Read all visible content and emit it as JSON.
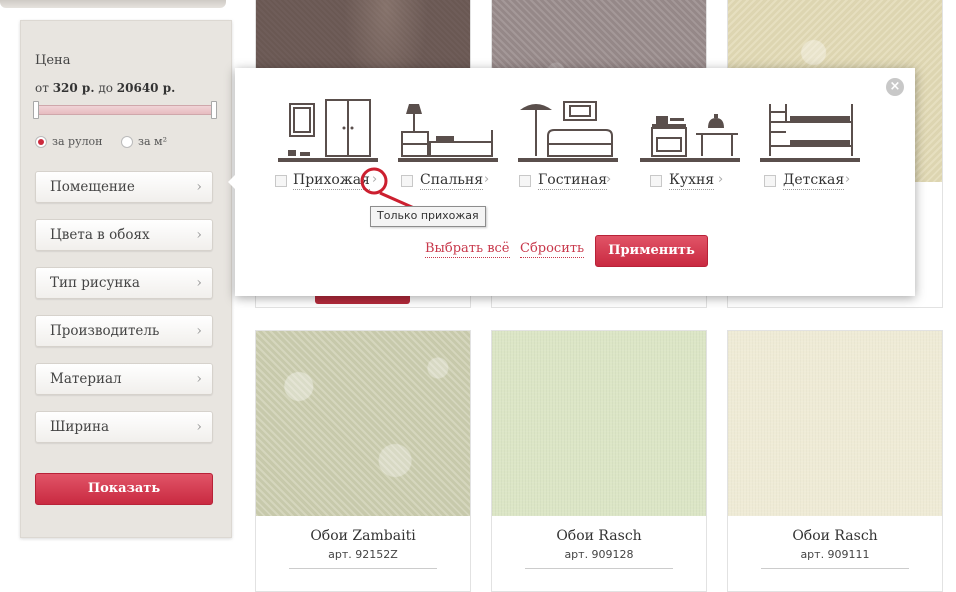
{
  "sidebar": {
    "price_title": "Цена",
    "price_from_label": "от",
    "price_from_value": "320 р.",
    "price_to_label": "до",
    "price_to_value": "20640 р.",
    "unit_options": [
      {
        "label": "за рулон",
        "selected": true
      },
      {
        "label": "за м²",
        "selected": false
      }
    ],
    "filters": [
      "Помещение",
      "Цвета в обоях",
      "Тип рисунка",
      "Производитель",
      "Материал",
      "Ширина"
    ],
    "show_button": "Показать"
  },
  "popup": {
    "rooms": [
      "Прихожая",
      "Спальня",
      "Гостиная",
      "Кухня",
      "Детская"
    ],
    "tooltip": "Только прихожая",
    "select_all": "Выбрать всё",
    "reset": "Сбросить",
    "apply": "Применить",
    "close_icon": "close-icon"
  },
  "products": [
    {
      "name": "Обои Zambaiti",
      "article": "арт. 92152Z"
    },
    {
      "name": "Обои Rasch",
      "article": "арт. 909128"
    },
    {
      "name": "Обои Rasch",
      "article": "арт. 909111"
    }
  ],
  "colors": {
    "accent": "#cc2a3d",
    "sidebar_bg": "#e8e5e0",
    "icon": "#5a4f4c"
  }
}
